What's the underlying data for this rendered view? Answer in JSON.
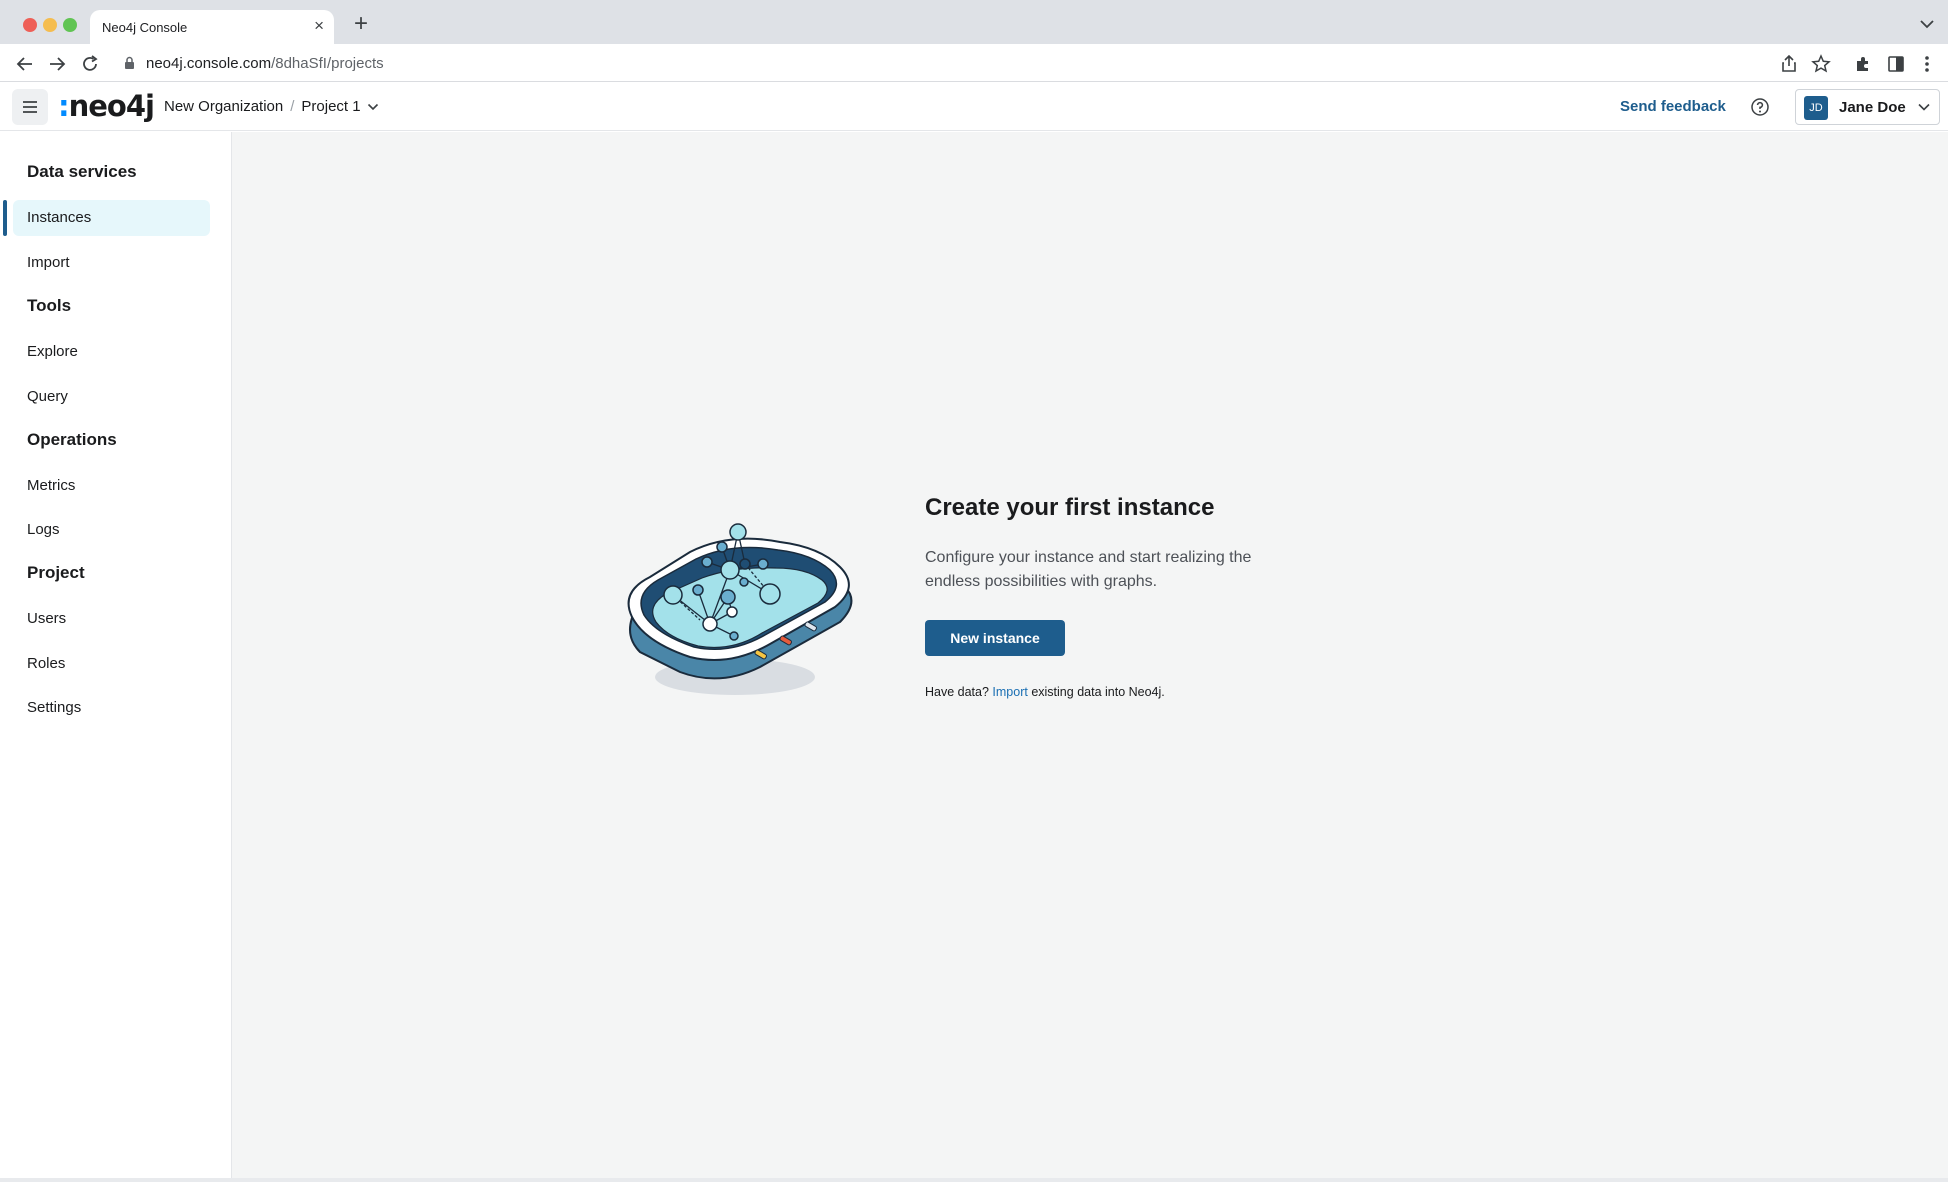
{
  "browser": {
    "tab_title": "Neo4j Console",
    "new_tab_symbol": "+",
    "close_symbol": "×",
    "url_host": "neo4j.console.com",
    "url_path": "/8dhaSfI/projects"
  },
  "header": {
    "logo_text": "neo4j",
    "organization": "New Organization",
    "separator": "/",
    "project": "Project 1",
    "feedback_label": "Send feedback",
    "user_initials": "JD",
    "user_name": "Jane Doe"
  },
  "sidebar": {
    "sections": [
      {
        "title": "Data services",
        "items": [
          "Instances",
          "Import"
        ]
      },
      {
        "title": "Tools",
        "items": [
          "Explore",
          "Query"
        ]
      },
      {
        "title": "Operations",
        "items": [
          "Metrics",
          "Logs"
        ]
      },
      {
        "title": "Project",
        "items": [
          "Users",
          "Roles",
          "Settings"
        ]
      }
    ],
    "active_item": "Instances"
  },
  "main": {
    "title": "Create your first instance",
    "description": "Configure your instance and start realizing the endless possibilities with graphs.",
    "button_label": "New instance",
    "hint_prefix": "Have data? ",
    "hint_link": "Import",
    "hint_suffix": " existing data into Neo4j."
  },
  "colors": {
    "brand": "#1e5d8d",
    "active_bg": "#e6f7fb",
    "main_bg": "#f4f5f5",
    "link": "#1a6fb3"
  },
  "icons": [
    "back-arrow-icon",
    "forward-arrow-icon",
    "reload-icon",
    "lock-icon",
    "share-icon",
    "star-icon",
    "extensions-icon",
    "sidepanel-icon",
    "kebab-icon",
    "hamburger-icon",
    "chevron-down-icon",
    "help-icon"
  ]
}
